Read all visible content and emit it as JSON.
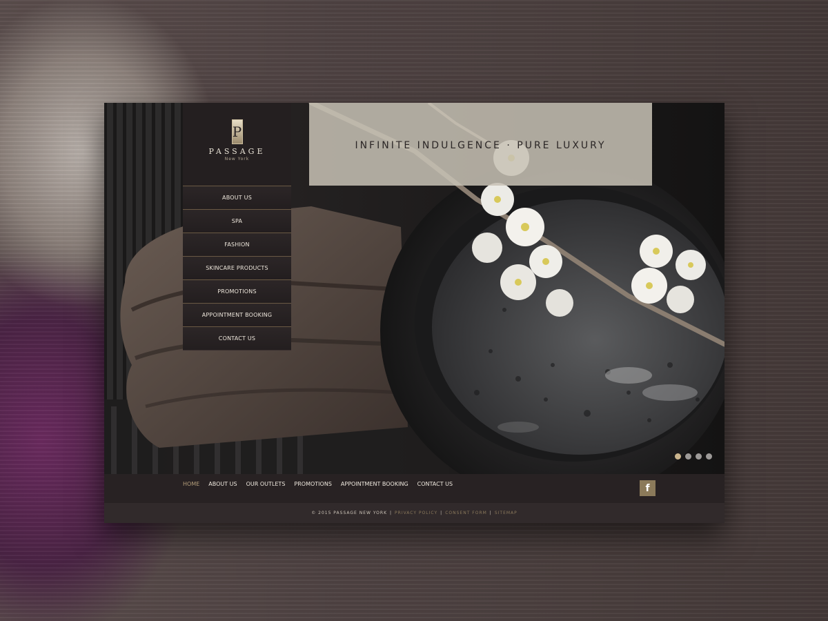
{
  "brand": {
    "logo_letter": "P",
    "name": "PASSAGE",
    "location": "New York"
  },
  "menu": {
    "items": [
      "ABOUT US",
      "SPA",
      "FASHION",
      "SKINCARE PRODUCTS",
      "PROMOTIONS",
      "APPOINTMENT BOOKING",
      "CONTACT US"
    ]
  },
  "hero": {
    "tagline": "INFINITE INDULGENCE · PURE LUXURY",
    "slides": {
      "count": 4,
      "active": 1
    }
  },
  "footer": {
    "links": [
      "HOME",
      "ABOUT US",
      "OUR OUTLETS",
      "PROMOTIONS",
      "APPOINTMENT BOOKING",
      "CONTACT US"
    ],
    "active_link": "HOME",
    "social_icon": "facebook-icon",
    "facebook_glyph": "f",
    "copyright": "© 2015 PASSAGE NEW YORK",
    "legal_links": [
      "PRIVACY POLICY",
      "CONSENT FORM",
      "SITEMAP"
    ]
  },
  "colors": {
    "accent_gold": "#b59f7b",
    "panel_dark": "#241f20",
    "tagline_box": "#c7c1b4"
  }
}
